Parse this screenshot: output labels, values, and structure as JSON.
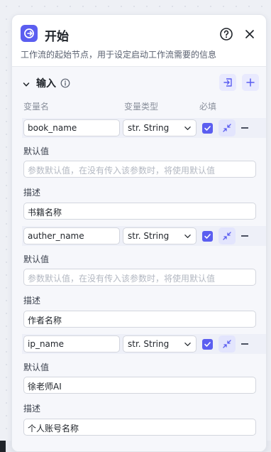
{
  "panel": {
    "title": "开始",
    "subtitle": "工作流的起始节点，用于设定启动工作流需要的信息",
    "icons": {
      "app": "workflow-start-icon",
      "help": "help-circle-icon",
      "close": "close-icon"
    }
  },
  "inputs": {
    "section_title": "输入",
    "columns": {
      "name": "变量名",
      "type": "变量类型",
      "required": "必填"
    },
    "default_label": "默认值",
    "desc_label": "描述",
    "default_placeholder": "参数默认值，在没有传入该参数时，将使用默认值",
    "params": [
      {
        "name": "book_name",
        "type": "str. String",
        "required": true,
        "default_value": "",
        "description": "书籍名称"
      },
      {
        "name": "auther_name",
        "type": "str. String",
        "required": true,
        "default_value": "",
        "description": "作者名称"
      },
      {
        "name": "ip_name",
        "type": "str. String",
        "required": true,
        "default_value": "徐老师AI",
        "description": "个人账号名称"
      }
    ]
  },
  "colors": {
    "accent": "#5b5ef0",
    "accent_soft": "#e9eafe",
    "border": "#d3d6de"
  }
}
